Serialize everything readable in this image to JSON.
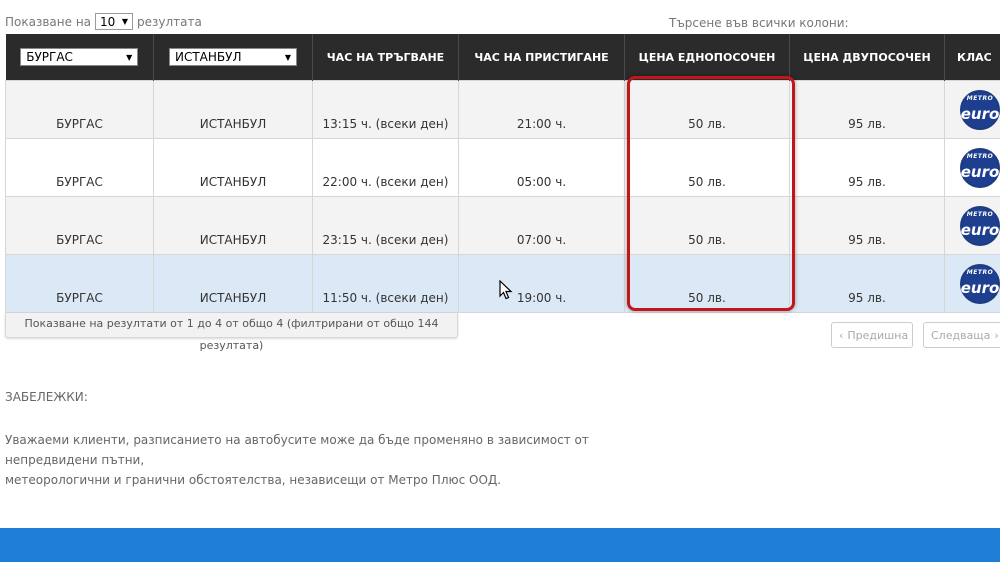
{
  "length_control": {
    "prefix": "Показване на",
    "value": "10",
    "suffix": "резултата"
  },
  "search": {
    "label": "Търсене във всички колони:"
  },
  "table": {
    "filters": {
      "from": "БУРГАС",
      "to": "ИСТАНБУЛ"
    },
    "headers": {
      "departure": "ЧАС НА ТРЪГВАНЕ",
      "arrival": "ЧАС НА ПРИСТИГАНЕ",
      "one_way": "ЦЕНА ЕДНОПОСОЧЕН",
      "round_trip": "ЦЕНА ДВУПОСОЧЕН",
      "class": "КЛАС"
    },
    "rows": [
      {
        "from": "БУРГАС",
        "to": "ИСТАНБУЛ",
        "departure": "13:15 ч. (всеки ден)",
        "arrival": "21:00 ч.",
        "one_way": "50 лв.",
        "round_trip": "95 лв."
      },
      {
        "from": "БУРГАС",
        "to": "ИСТАНБУЛ",
        "departure": "22:00 ч. (всеки ден)",
        "arrival": "05:00 ч.",
        "one_way": "50 лв.",
        "round_trip": "95 лв."
      },
      {
        "from": "БУРГАС",
        "to": "ИСТАНБУЛ",
        "departure": "23:15 ч. (всеки ден)",
        "arrival": "07:00 ч.",
        "one_way": "50 лв.",
        "round_trip": "95 лв."
      },
      {
        "from": "БУРГАС",
        "to": "ИСТАНБУЛ",
        "departure": "11:50 ч. (всеки ден)",
        "arrival": "19:00 ч.",
        "one_way": "50 лв.",
        "round_trip": "95 лв."
      }
    ],
    "class_logo": {
      "top": "METRO",
      "main": "euro"
    }
  },
  "info": "Показване на резултати от 1 до 4 от общо 4 (филтрирани от общо 144 резултата)",
  "pagination": {
    "previous": "Предишна",
    "next": "Следваща"
  },
  "notes": {
    "title": "ЗАБЕЛЕЖКИ:",
    "line1": "Уважаеми клиенти, разписанието на автобусите може да бъде променяно в зависимост от непредвидени пътни,",
    "line2": "метеорологични и гранични обстоятелства, независещи от Метро Плюс ООД."
  },
  "colors": {
    "header_bg": "#2b2b2b",
    "highlight_row": "#dbe8f6",
    "annotation_box": "#c3161c",
    "footer": "#1f7fd8"
  }
}
